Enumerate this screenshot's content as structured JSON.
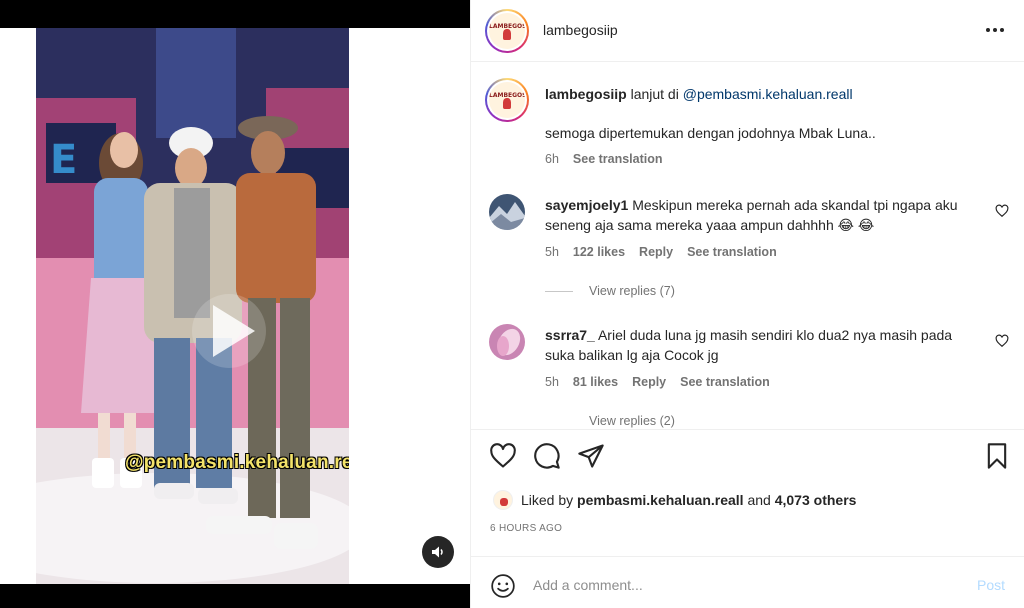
{
  "post": {
    "username": "lambegosiip",
    "logo_text": "LAMBEGOSIIP",
    "more_icon": "more-horizontal-icon"
  },
  "media": {
    "watermark": "@pembasmi.kehaluan.reall",
    "play_icon": "play-icon",
    "volume_icon": "volume-icon"
  },
  "caption": {
    "username": "lambegosiip",
    "prefix": "lanjut di",
    "mention": "@pembasmi.kehaluan.reall",
    "text": "semoga dipertemukan dengan jodohnya Mbak Luna..",
    "time": "6h",
    "see_translation": "See translation"
  },
  "comments": [
    {
      "username": "sayemjoely1",
      "text": "Meskipun mereka pernah ada skandal tpi ngapa aku seneng aja sama mereka yaaa ampun dahhhh 😂 😂",
      "time": "5h",
      "likes": "122 likes",
      "reply": "Reply",
      "see_translation": "See translation",
      "view_replies": "View replies (7)",
      "avatar_color": "#3f5573"
    },
    {
      "username": "ssrra7_",
      "text": "Ariel duda luna jg masih sendiri klo dua2 nya masih pada suka balikan lg aja Cocok jg",
      "time": "5h",
      "likes": "81 likes",
      "reply": "Reply",
      "see_translation": "See translation",
      "view_replies": "View replies (2)",
      "avatar_color": "#c985b3"
    }
  ],
  "actions": {
    "like_icon": "heart-icon",
    "comment_icon": "comment-icon",
    "share_icon": "send-icon",
    "save_icon": "bookmark-icon"
  },
  "likes": {
    "prefix": "Liked by",
    "user": "pembasmi.kehaluan.reall",
    "middle": "and",
    "others": "4,073 others"
  },
  "time_ago": "6 HOURS AGO",
  "comment_box": {
    "placeholder": "Add a comment...",
    "post_label": "Post",
    "emoji_icon": "emoji-icon"
  },
  "colors": {
    "accent": "#0095f6",
    "post_disabled": "#b3dbff",
    "mention": "#00376b",
    "secondary_text": "#737373"
  }
}
